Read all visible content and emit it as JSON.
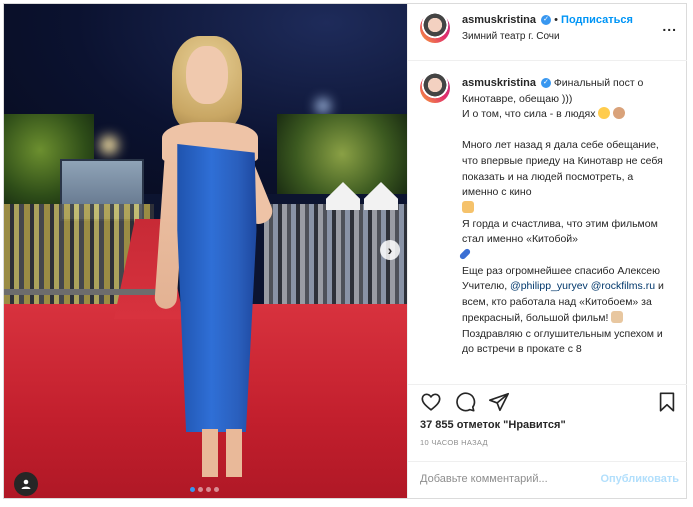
{
  "post": {
    "username": "asmuskristina",
    "follow_label": "Подписаться",
    "separator": "•",
    "location": "Зимний театр г. Сочи",
    "more_label": "...",
    "caption_lines": [
      "Финальный пост о Кинотавре, обещаю )))",
      "И о том, что сила - в людях"
    ],
    "caption_paragraphs": [
      "Много лет назад я дала себе обещание, что впервые приеду на Кинотавр не себя показать и на людей посмотреть, а именно с кино",
      "Я горда и счастлива, что этим фильмом стал именно «Китобой»"
    ],
    "thanks_text_1": "Еще раз огромнейшее спасибо Алексею Учителю,",
    "mention_1": "@philipp_yuryev",
    "mention_2": "@rockfilms.ru",
    "thanks_text_2": "и всем, кто работала над «Китобоем» за прекрасный, большой фильм!",
    "closing": "Поздравляю с оглушительным успехом и до встречи в прокате с 8",
    "likes": "37 855 отметок \"Нравится\"",
    "time": "10 ЧАСОВ НАЗАД",
    "comment_placeholder": "Добавьте комментарий...",
    "publish_label": "Опубликовать"
  },
  "icons": {
    "verified": "verified-badge-icon",
    "like": "heart-icon",
    "comment": "comment-icon",
    "share": "paper-plane-icon",
    "save": "bookmark-icon",
    "user_tag": "user-tag-icon",
    "carousel_next": "chevron-right-icon"
  },
  "carousel": {
    "slides": 4,
    "active_index": 0
  },
  "colors": {
    "accent": "#0095f6",
    "verified": "#3897f0",
    "carpet": "#c21f2d",
    "dress": "#2f6fd6"
  }
}
